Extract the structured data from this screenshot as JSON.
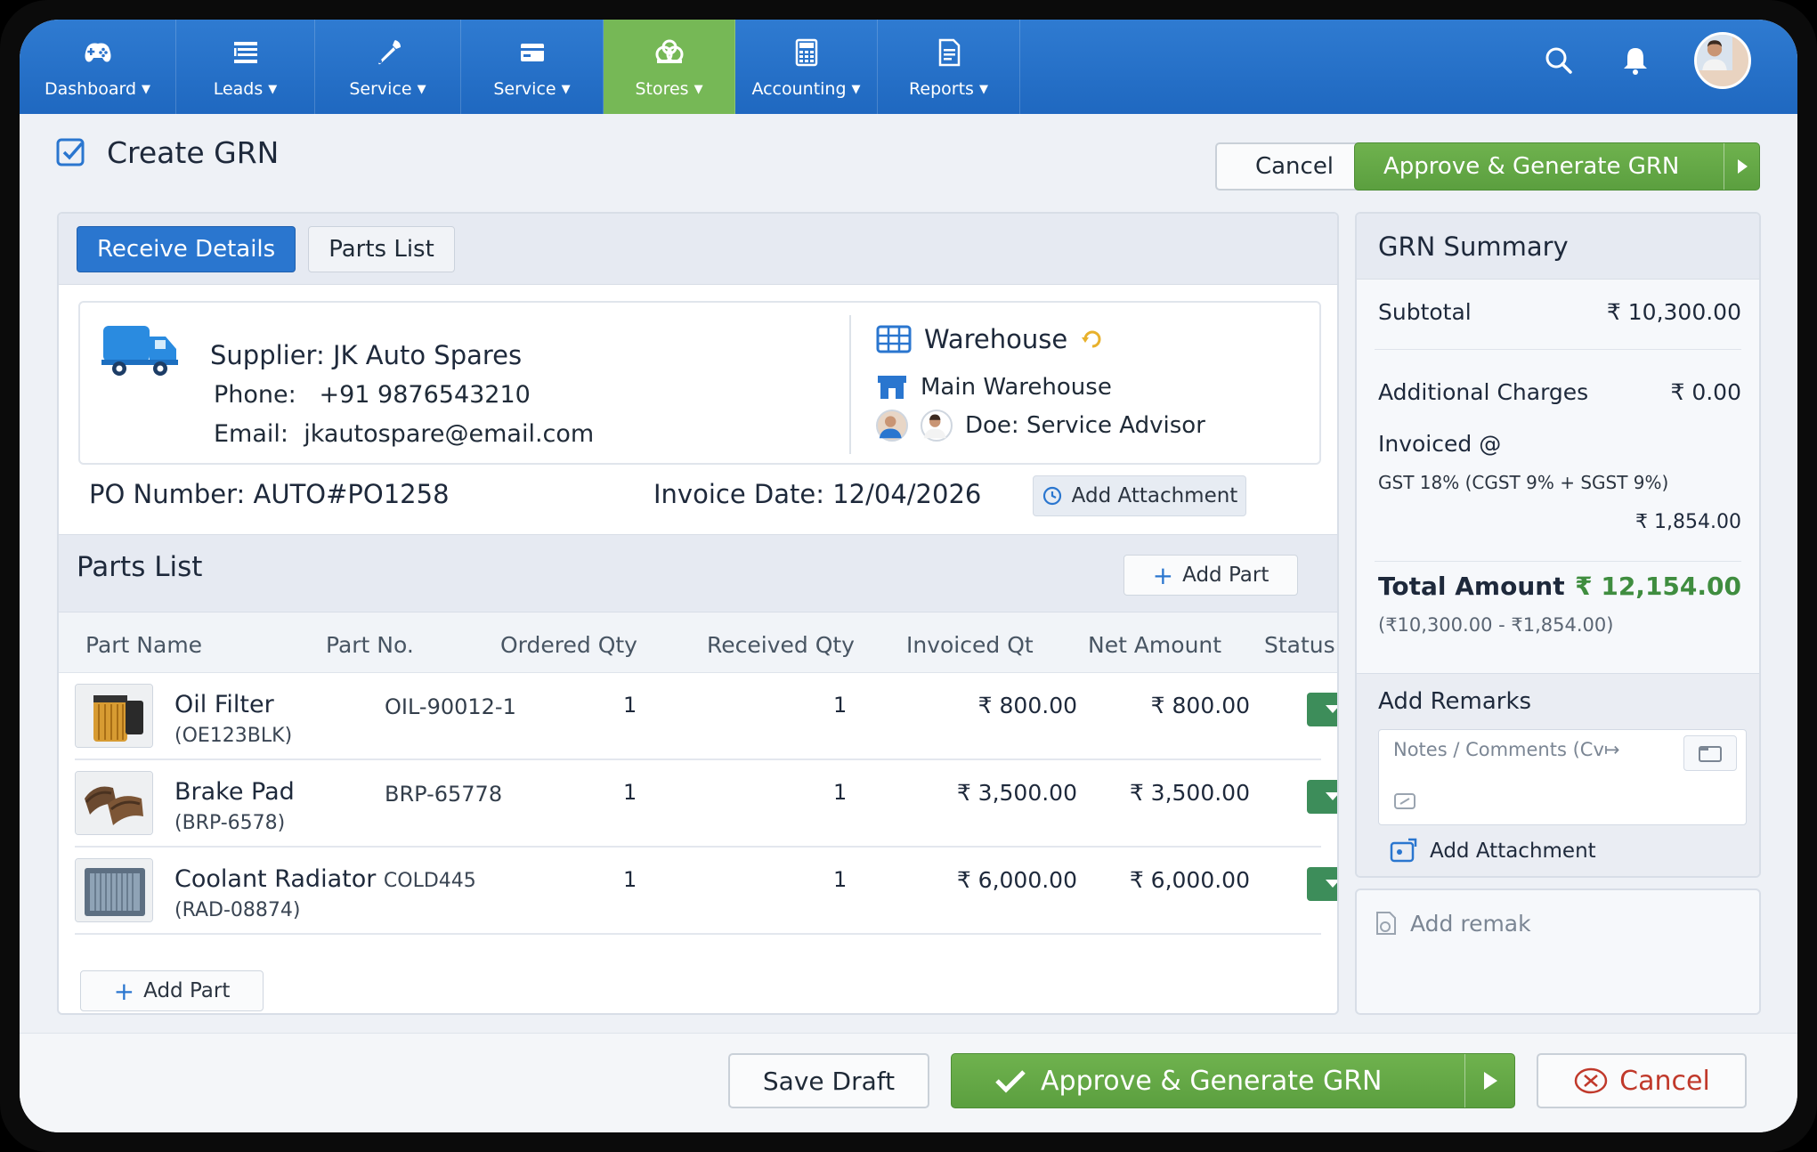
{
  "nav": {
    "items": [
      {
        "label": "Dashboard",
        "icon": "gamepad-icon"
      },
      {
        "label": "Leads",
        "icon": "list-icon"
      },
      {
        "label": "Service",
        "icon": "wrench-icon"
      },
      {
        "label": "Service",
        "icon": "card-icon"
      },
      {
        "label": "Stores",
        "icon": "stores-icon",
        "active": true
      },
      {
        "label": "Accounting",
        "icon": "calculator-icon"
      },
      {
        "label": "Reports",
        "icon": "report-icon"
      }
    ],
    "active_color": "#76b856",
    "bar_color": "#2a72cb"
  },
  "header": {
    "title": "Create GRN",
    "cancel_label": "Cancel",
    "approve_label": "Approve & Generate GRN"
  },
  "tabs": {
    "receive": "Receive Details",
    "parts": "Parts List"
  },
  "supplier": {
    "name": "Supplier: JK Auto Spares",
    "phone_label": "Phone:",
    "phone": "+91 9876543210",
    "email_label": "Email:",
    "email": "jkautospare@email.com"
  },
  "warehouse": {
    "title": "Warehouse",
    "name": "Main Warehouse",
    "advisor": "Doe: Service Advisor"
  },
  "po": {
    "label": "PO Number:",
    "value": "AUTO#PO1258",
    "invoice_label": "Invoice Date:",
    "invoice_date": "12/04/2026",
    "attachment_label": "Add Attachment"
  },
  "parts": {
    "title": "Parts List",
    "add_label": "Add Part",
    "columns": [
      "Part Name",
      "Part No.",
      "Ordered Qty",
      "Received Qty",
      "Invoiced Qt",
      "Net Amount",
      "Status"
    ],
    "rows": [
      {
        "name": "Oil Filter",
        "extra": "",
        "code": "(OE123BLK)",
        "part_no": "OIL-90012-1",
        "ordered": "1",
        "received": "1",
        "invoiced": "₹ 800.00",
        "net": "₹ 800.00"
      },
      {
        "name": "Brake Pad",
        "extra": "",
        "code": "(BRP-6578)",
        "part_no": "BRP-65778",
        "ordered": "1",
        "received": "1",
        "invoiced": "₹ 3,500.00",
        "net": "₹ 3,500.00"
      },
      {
        "name": "Coolant Radiator",
        "extra": "COLD445",
        "code": "(RAD-08874)",
        "part_no": "",
        "ordered": "1",
        "received": "1",
        "invoiced": "₹ 6,000.00",
        "net": "₹ 6,000.00"
      }
    ]
  },
  "summary": {
    "title": "GRN Summary",
    "subtotal_label": "Subtotal",
    "subtotal": "₹ 10,300.00",
    "charges_label": "Additional Charges",
    "charges": "₹ 0.00",
    "invoiced_label": "Invoiced @",
    "gst_label": "GST 18% (CGST 9% + SGST 9%)",
    "gst_value": "₹ 1,854.00",
    "total_label": "Total Amount",
    "total": "₹ 12,154.00",
    "total_note": "(₹10,300.00 - ₹1,854.00)",
    "total_color": "#3f8d3f",
    "remarks_title": "Add Remarks",
    "notes_placeholder": "Notes / Comments (Cv↦",
    "add_attachment": "Add Attachment",
    "add_remark": "Add remak"
  },
  "footer": {
    "save_label": "Save Draft",
    "approve_label": "Approve & Generate GRN",
    "cancel_label": "Cancel"
  }
}
